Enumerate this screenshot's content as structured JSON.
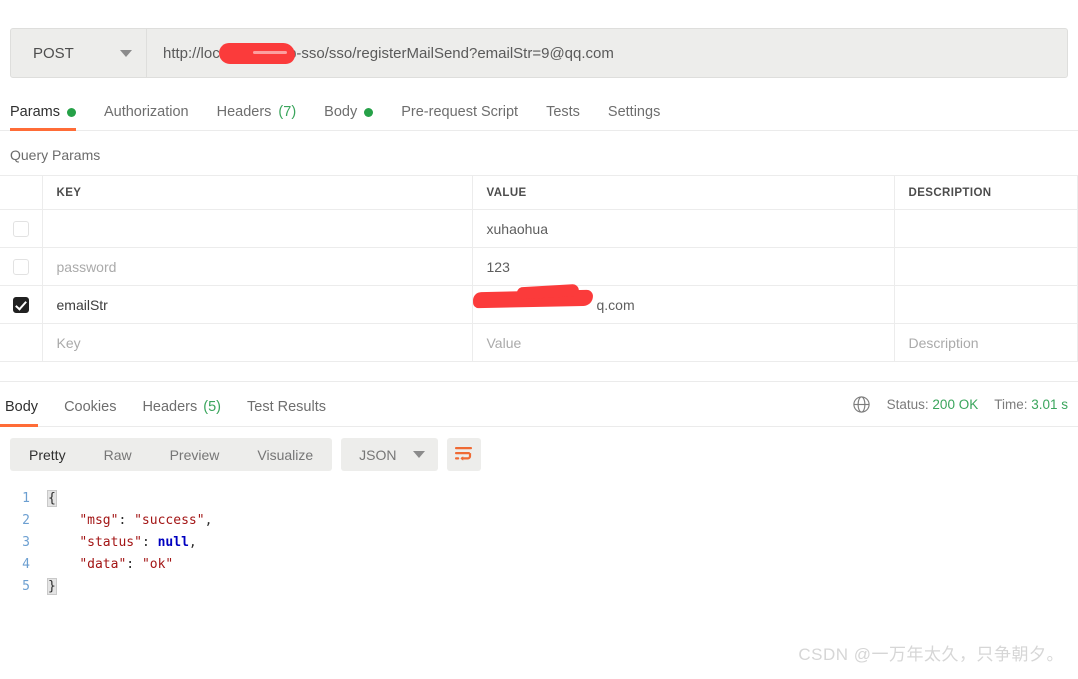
{
  "request": {
    "method": "POST",
    "method_caret_icon": "chevron-down-icon",
    "url": "http://localhost/shop-sso/sso/registerMailSend?emailStr=9",
    "url_suffix": "@qq.com",
    "url_redacted": true,
    "tabs": [
      {
        "label": "Params",
        "dot": true,
        "active": true
      },
      {
        "label": "Authorization",
        "dot": false,
        "active": false
      },
      {
        "label": "Headers",
        "count": "(7)",
        "dot": false,
        "active": false
      },
      {
        "label": "Body",
        "dot": true,
        "active": false
      },
      {
        "label": "Pre-request Script",
        "dot": false,
        "active": false
      },
      {
        "label": "Tests",
        "dot": false,
        "active": false
      },
      {
        "label": "Settings",
        "dot": false,
        "active": false
      }
    ]
  },
  "params": {
    "section_title": "Query Params",
    "headers": {
      "key": "KEY",
      "value": "VALUE",
      "description": "DESCRIPTION"
    },
    "rows": [
      {
        "checked": false,
        "key": "",
        "key_placeholder": "",
        "value": "xuhaohua",
        "description": "",
        "redacted": false
      },
      {
        "checked": false,
        "key": "password",
        "key_placeholder": "",
        "value": "123",
        "description": "",
        "redacted": false
      },
      {
        "checked": true,
        "key": "emailStr",
        "key_placeholder": "",
        "value": "q.com",
        "description": "",
        "redacted": true
      },
      {
        "checked": false,
        "key": "",
        "key_placeholder": "Key",
        "value": "",
        "value_placeholder": "Value",
        "description_placeholder": "Description",
        "redacted": false
      }
    ]
  },
  "response": {
    "tabs": [
      {
        "label": "Body",
        "active": true
      },
      {
        "label": "Cookies",
        "active": false
      },
      {
        "label": "Headers",
        "count": "(5)",
        "active": false
      },
      {
        "label": "Test Results",
        "active": false
      }
    ],
    "globe_icon": "globe-icon",
    "status_label": "Status:",
    "status_value": "200 OK",
    "time_label": "Time:",
    "time_value": "3.01 s",
    "format_tabs": [
      {
        "label": "Pretty",
        "active": true
      },
      {
        "label": "Raw",
        "active": false
      },
      {
        "label": "Preview",
        "active": false
      },
      {
        "label": "Visualize",
        "active": false
      }
    ],
    "language": "JSON",
    "language_caret_icon": "chevron-down-icon",
    "wrap_icon": "wrap-text-icon",
    "body_lines": [
      {
        "n": "1",
        "segments": [
          {
            "t": "{",
            "c": "brace-hl tok-punct"
          }
        ]
      },
      {
        "n": "2",
        "segments": [
          {
            "t": "    ",
            "c": ""
          },
          {
            "t": "\"msg\"",
            "c": "tok-key"
          },
          {
            "t": ": ",
            "c": "tok-punct"
          },
          {
            "t": "\"success\"",
            "c": "tok-str"
          },
          {
            "t": ",",
            "c": "tok-punct"
          }
        ]
      },
      {
        "n": "3",
        "segments": [
          {
            "t": "    ",
            "c": ""
          },
          {
            "t": "\"status\"",
            "c": "tok-key"
          },
          {
            "t": ": ",
            "c": "tok-punct"
          },
          {
            "t": "null",
            "c": "tok-null"
          },
          {
            "t": ",",
            "c": "tok-punct"
          }
        ]
      },
      {
        "n": "4",
        "segments": [
          {
            "t": "    ",
            "c": ""
          },
          {
            "t": "\"data\"",
            "c": "tok-key"
          },
          {
            "t": ": ",
            "c": "tok-punct"
          },
          {
            "t": "\"ok\"",
            "c": "tok-str"
          }
        ]
      },
      {
        "n": "5",
        "segments": [
          {
            "t": "}",
            "c": "brace-hl tok-punct"
          }
        ]
      }
    ]
  },
  "watermark": "CSDN @一万年太久，只争朝夕。",
  "colors": {
    "accent": "#ff6c37",
    "success": "#3aa55c",
    "dot_green": "#26a148",
    "redaction_red": "#fb3b3b",
    "toolbar_bg": "#ededeb"
  }
}
